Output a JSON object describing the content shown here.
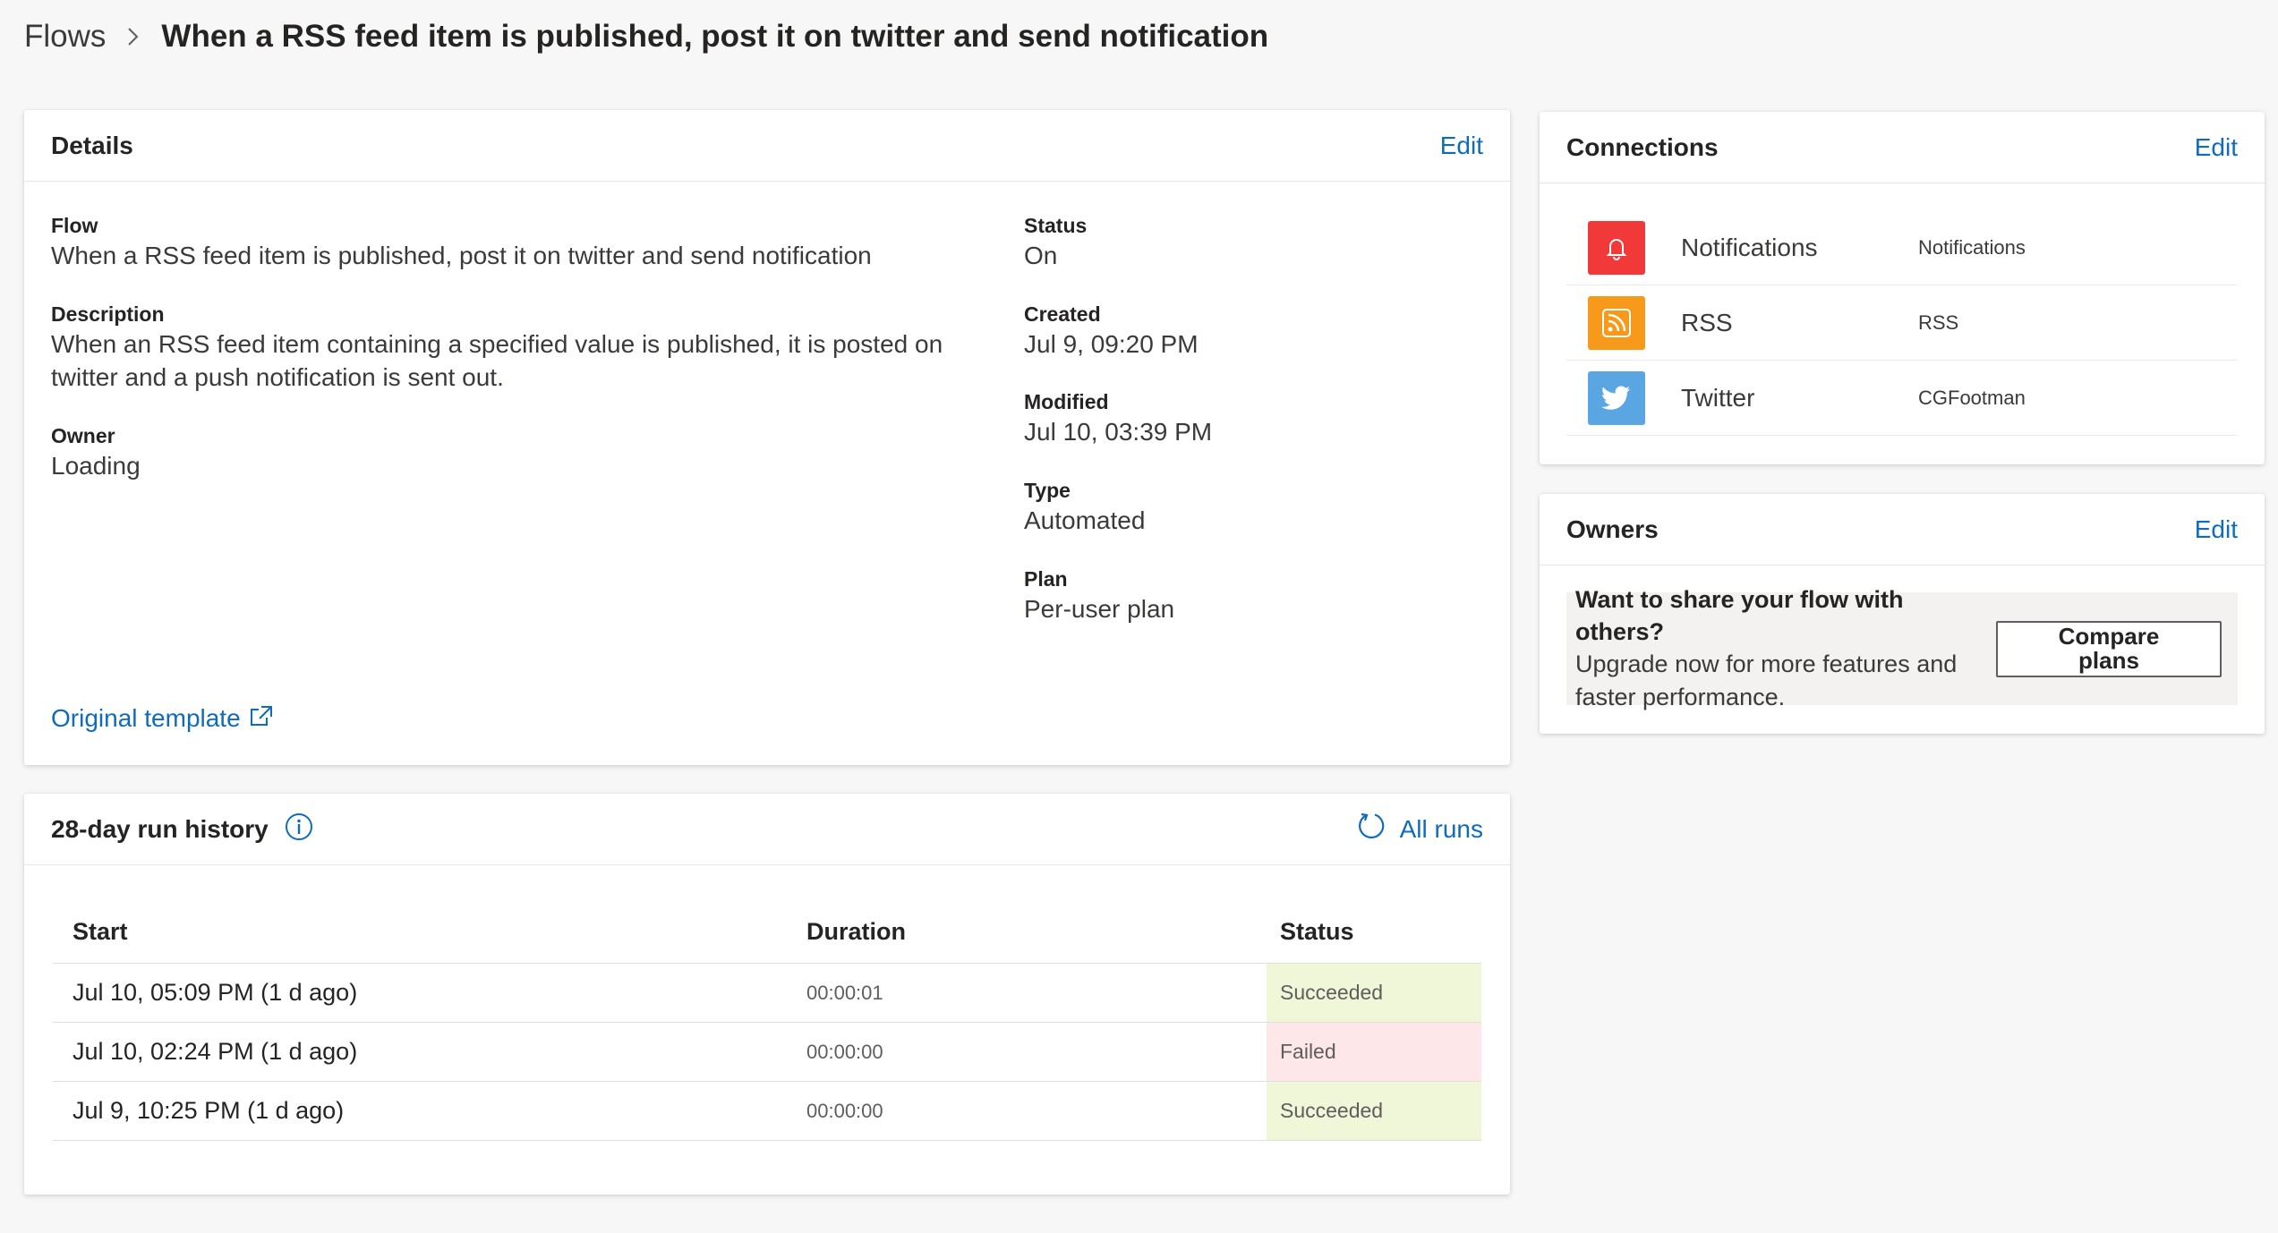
{
  "breadcrumb": {
    "root": "Flows",
    "title": "When a RSS feed item is published, post it on twitter and send notification"
  },
  "details": {
    "title": "Details",
    "edit_label": "Edit",
    "flow_label": "Flow",
    "flow_value": "When a RSS feed item is published, post it on twitter and send notification",
    "description_label": "Description",
    "description_line1": "When an RSS feed item containing a specified value is published, it is posted on",
    "description_line2": "twitter and a push notification is sent out.",
    "owner_label": "Owner",
    "owner_value": "Loading",
    "status_label": "Status",
    "status_value": "On",
    "created_label": "Created",
    "created_value": "Jul 9, 09:20 PM",
    "modified_label": "Modified",
    "modified_value": "Jul 10, 03:39 PM",
    "type_label": "Type",
    "type_value": "Automated",
    "plan_label": "Plan",
    "plan_value": "Per-user plan",
    "template_link": "Original template"
  },
  "history": {
    "title": "28-day run history",
    "all_runs_label": "All runs",
    "columns": {
      "start": "Start",
      "duration": "Duration",
      "status": "Status"
    },
    "rows": [
      {
        "start": "Jul 10, 05:09 PM (1 d ago)",
        "duration": "00:00:01",
        "status": "Succeeded"
      },
      {
        "start": "Jul 10, 02:24 PM (1 d ago)",
        "duration": "00:00:00",
        "status": "Failed"
      },
      {
        "start": "Jul 9, 10:25 PM (1 d ago)",
        "duration": "00:00:00",
        "status": "Succeeded"
      }
    ]
  },
  "connections": {
    "title": "Connections",
    "edit_label": "Edit",
    "items": [
      {
        "name": "Notifications",
        "account": "Notifications",
        "icon": "bell-icon",
        "color": "#f13939"
      },
      {
        "name": "RSS",
        "account": "RSS",
        "icon": "rss-icon",
        "color": "#f79a1b"
      },
      {
        "name": "Twitter",
        "account": "CGFootman",
        "icon": "twitter-bird-icon",
        "color": "#5aa6e3"
      }
    ]
  },
  "owners": {
    "title": "Owners",
    "edit_label": "Edit",
    "question": "Want to share your flow with others?",
    "upgrade_line1": "Upgrade now for more features and",
    "upgrade_line2": "faster performance.",
    "compare_line1": "Compare",
    "compare_line2": "plans"
  },
  "colors": {
    "link": "#0f6cbd",
    "succeeded_bg": "#f0f6d8",
    "failed_bg": "#fde7e9"
  }
}
